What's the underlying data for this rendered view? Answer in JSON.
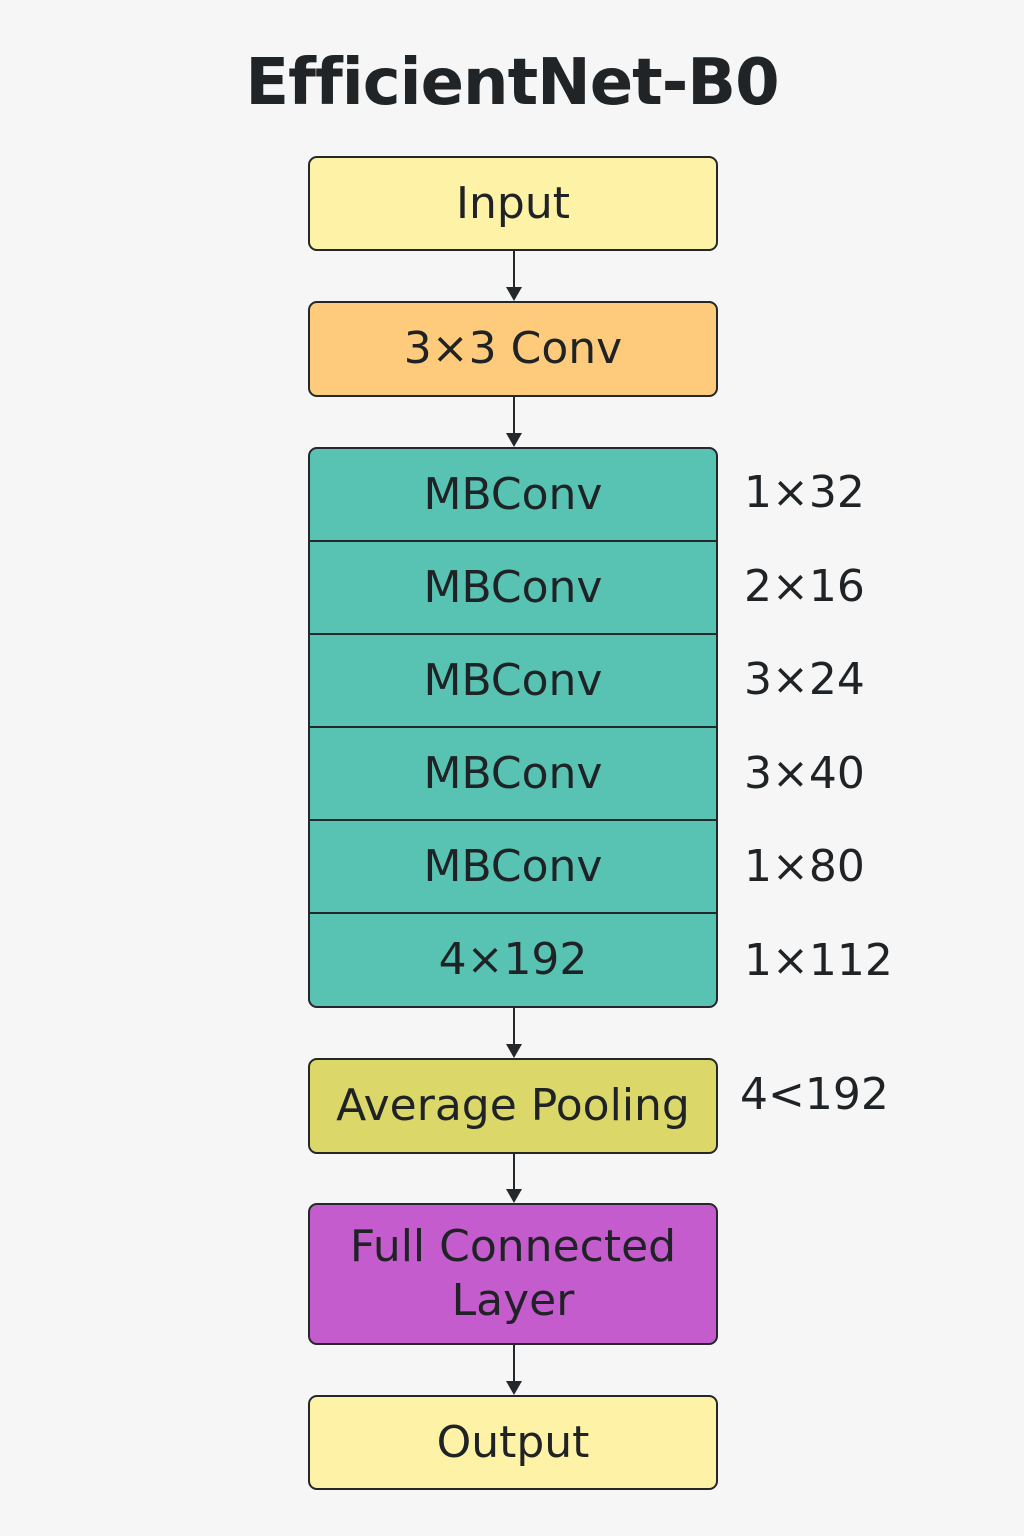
{
  "title": "EfficientNet-B0",
  "colors": {
    "input": "#fdf2a5",
    "conv": "#fdcb7b",
    "mbconv": "#58c2b3",
    "pooling": "#dbd869",
    "fc": "#c55ccd",
    "output": "#fdf2a5",
    "background": "#f6f6f6"
  },
  "nodes": {
    "input": "Input",
    "conv": "3×3 Conv",
    "pooling": "Average Pooling",
    "fc": "Full Connected Layer",
    "output": "Output"
  },
  "mbconv_stack": [
    {
      "label": "MBConv",
      "side": "1×32"
    },
    {
      "label": "MBConv",
      "side": "2×16"
    },
    {
      "label": "MBConv",
      "side": "3×24"
    },
    {
      "label": "MBConv",
      "side": "3×40"
    },
    {
      "label": "MBConv",
      "side": "1×80"
    },
    {
      "label": "4×192",
      "side": "1×112"
    }
  ],
  "pooling_side": "4<192"
}
